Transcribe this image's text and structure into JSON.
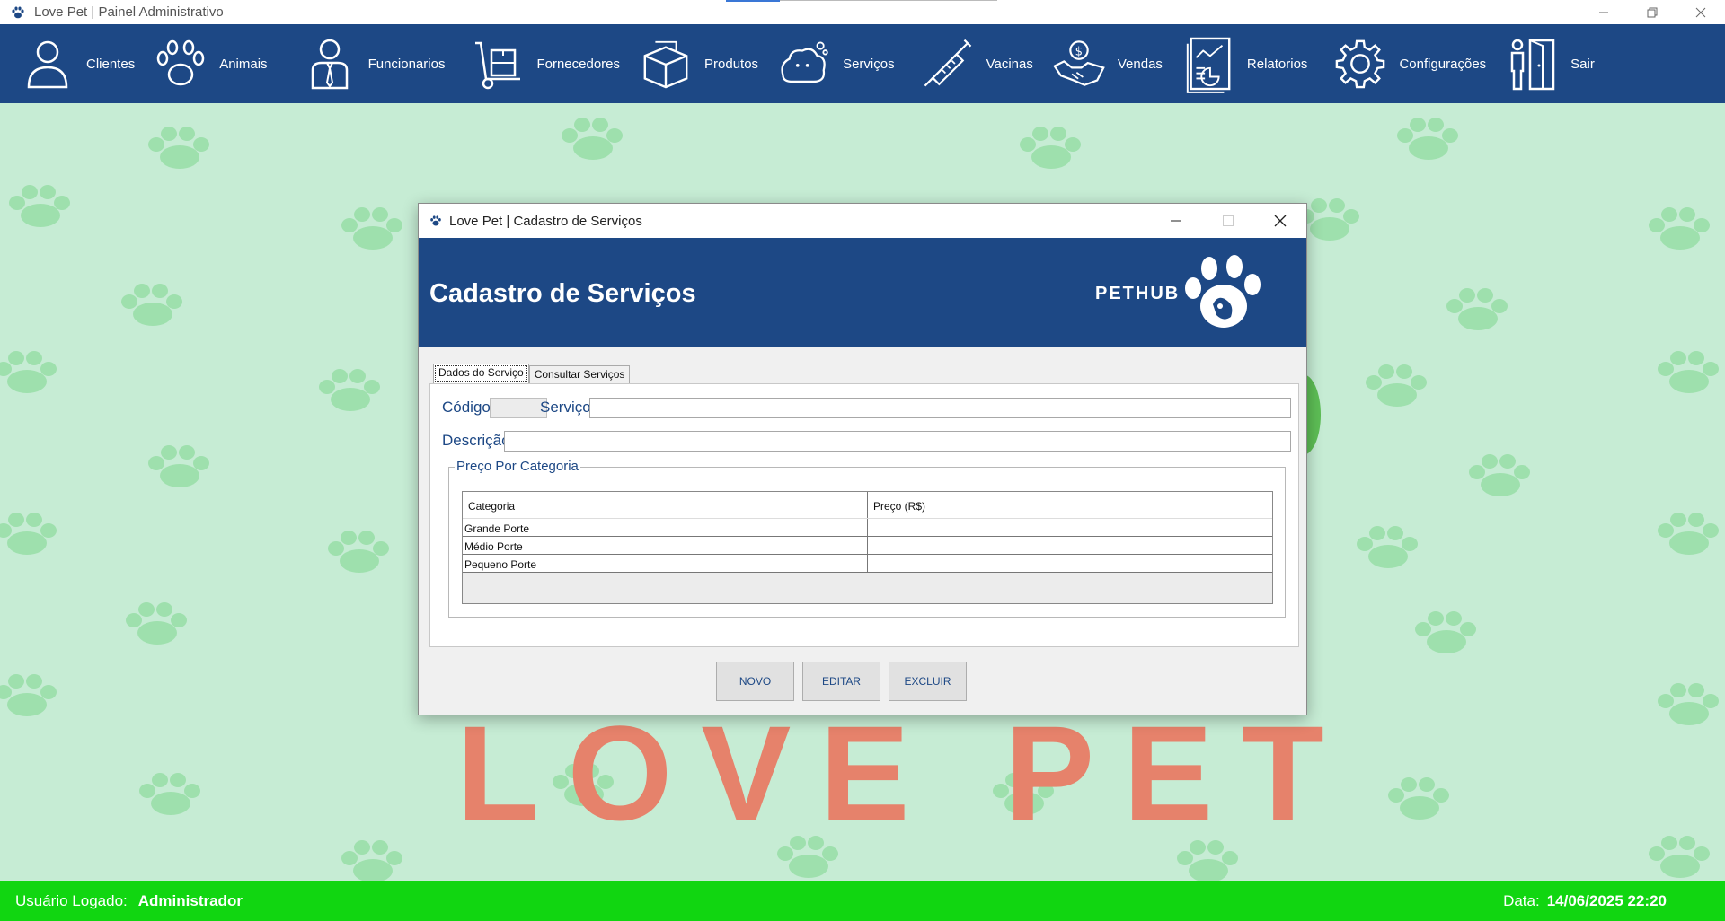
{
  "window": {
    "title": "Love Pet | Painel Administrativo",
    "controls": [
      "minimize",
      "restore",
      "close"
    ]
  },
  "menu": {
    "items": [
      {
        "label": "Clientes",
        "icon": "person-icon"
      },
      {
        "label": "Animais",
        "icon": "paw-icon"
      },
      {
        "label": "Funcionarios",
        "icon": "employee-icon"
      },
      {
        "label": "Fornecedores",
        "icon": "hand-truck-icon"
      },
      {
        "label": "Produtos",
        "icon": "box-icon"
      },
      {
        "label": "Serviços",
        "icon": "dog-bath-icon"
      },
      {
        "label": "Vacinas",
        "icon": "syringe-icon"
      },
      {
        "label": "Vendas",
        "icon": "handshake-dollar-icon"
      },
      {
        "label": "Relatorios",
        "icon": "report-icon"
      },
      {
        "label": "Configurações",
        "icon": "gear-icon"
      },
      {
        "label": "Sair",
        "icon": "exit-door-icon"
      }
    ]
  },
  "background": {
    "logo_text": "LOVE PET"
  },
  "dialog": {
    "title": "Love Pet | Cadastro de Serviços",
    "header_title": "Cadastro de Serviços",
    "brand": "PETHUB",
    "tabs": [
      {
        "label": "Dados do Serviço",
        "active": true
      },
      {
        "label": "Consultar Serviços",
        "active": false
      }
    ],
    "form": {
      "codigo_label": "Código:",
      "codigo_value": "",
      "servico_label": "Serviço:",
      "servico_value": "",
      "descricao_label": "Descrição:",
      "descricao_value": ""
    },
    "price_group": {
      "title": "Preço Por Categoria",
      "columns": [
        "Categoria",
        "Preço (R$)"
      ],
      "rows": [
        {
          "categoria": "Grande Porte",
          "preco": ""
        },
        {
          "categoria": "Médio Porte",
          "preco": ""
        },
        {
          "categoria": "Pequeno Porte",
          "preco": ""
        }
      ]
    },
    "buttons": {
      "novo": "NOVO",
      "editar": "EDITAR",
      "excluir": "EXCLUIR"
    }
  },
  "status": {
    "user_label": "Usuário Logado:",
    "user_value": "Administrador",
    "date_label": "Data:",
    "date_value": "14/06/2025 22:20"
  },
  "colors": {
    "primary": "#1d4885",
    "status_green": "#11d611",
    "background": "#c6ecd4",
    "paw": "#9ee0ad",
    "logo": "#e6826b"
  }
}
